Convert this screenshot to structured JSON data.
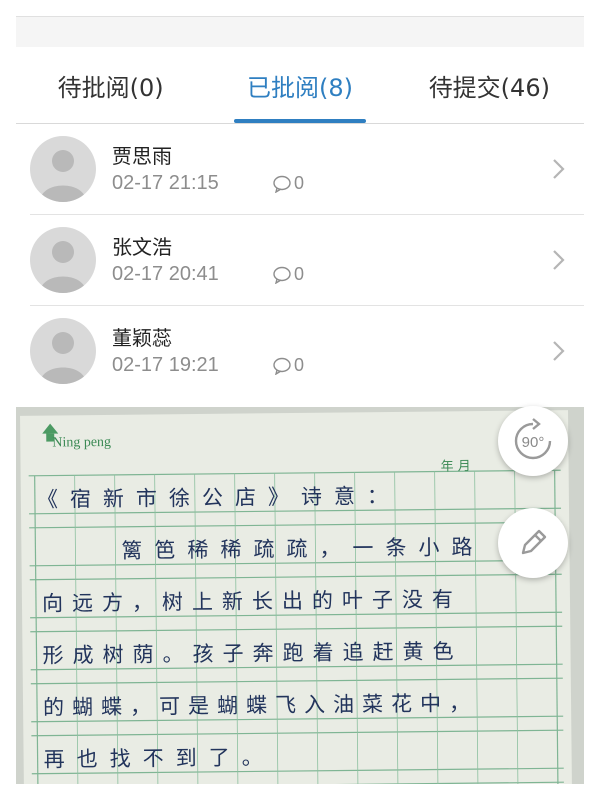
{
  "tabs": [
    {
      "label": "待批阅(0)"
    },
    {
      "label": "已批阅(8)"
    },
    {
      "label": "待提交(46)"
    }
  ],
  "active_tab_index": 1,
  "accent_color": "#2f7fc1",
  "students": [
    {
      "name": "贾思雨",
      "time": "02-17 21:15",
      "comments": "0"
    },
    {
      "name": "张文浩",
      "time": "02-17 20:41",
      "comments": "0"
    },
    {
      "name": "董颖蕊",
      "time": "02-17 19:21",
      "comments": "0"
    }
  ],
  "submission_photo": {
    "paper_brand": "Ning peng",
    "date_label": "年 月",
    "handwriting_lines": [
      "《宿新市徐公店》诗意：",
      "篱笆稀稀疏疏，一条小路",
      "向远方，树上新长出的叶子没有",
      "形成树荫。孩子奔跑着追赶黄色",
      "的蝴蝶，可是蝴蝶飞入油菜花中，",
      "再也找不到了。"
    ]
  },
  "tools": {
    "rotate_label": "90°",
    "rotate_icon": "rotate-icon",
    "annotate_icon": "pencil-icon"
  }
}
